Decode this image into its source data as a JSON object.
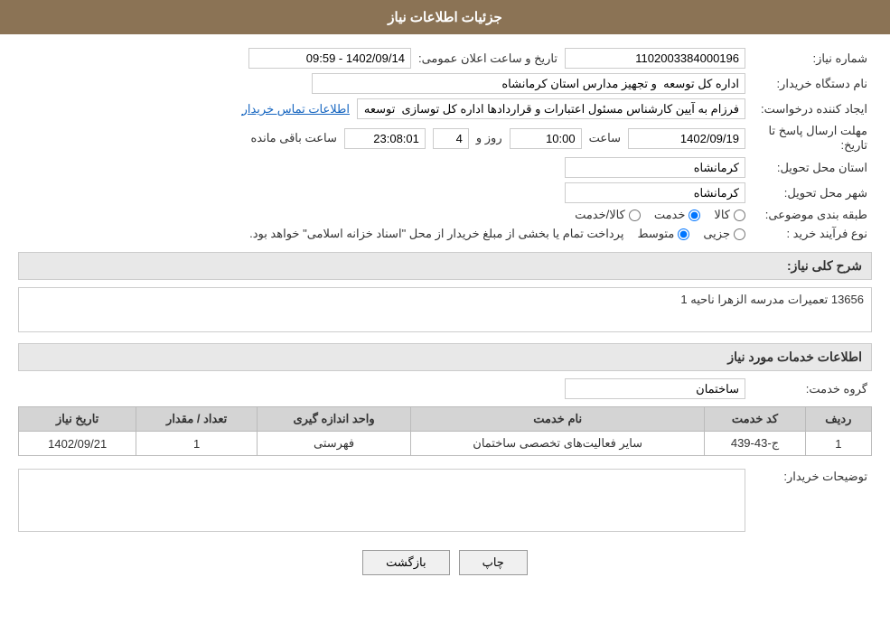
{
  "header": {
    "title": "جزئیات اطلاعات نیاز"
  },
  "form": {
    "need_number_label": "شماره نیاز:",
    "need_number_value": "1102003384000196",
    "announce_date_label": "تاریخ و ساعت اعلان عمومی:",
    "announce_date_value": "1402/09/14 - 09:59",
    "buyer_org_label": "نام دستگاه خریدار:",
    "buyer_org_value": "اداره کل توسعه  و تجهیز مدارس استان کرمانشاه",
    "creator_label": "ایجاد کننده درخواست:",
    "creator_value": "فرزام به آیین کارشناس مسئول اعتبارات و قراردادها اداره کل توسازی  توسعه و ت",
    "contact_link": "اطلاعات تماس خریدار",
    "deadline_label": "مهلت ارسال پاسخ تا تاریخ:",
    "deadline_date": "1402/09/19",
    "deadline_time_label": "ساعت",
    "deadline_time": "10:00",
    "deadline_days_label": "روز و",
    "deadline_days": "4",
    "deadline_remain_label": "ساعت باقی مانده",
    "deadline_remain": "23:08:01",
    "province_label": "استان محل تحویل:",
    "province_value": "کرمانشاه",
    "city_label": "شهر محل تحویل:",
    "city_value": "کرمانشاه",
    "category_label": "طبقه بندی موضوعی:",
    "category_options": [
      "کالا",
      "خدمت",
      "کالا/خدمت"
    ],
    "category_selected": "خدمت",
    "purchase_type_label": "نوع فرآیند خرید :",
    "purchase_type_options": [
      "جزیی",
      "متوسط"
    ],
    "purchase_type_note": "پرداخت تمام یا بخشی از مبلغ خریدار از محل \"اسناد خزانه اسلامی\" خواهد بود.",
    "purchase_type_selected": "متوسط",
    "need_summary_label": "شرح کلی نیاز:",
    "need_summary_value": "13656 تعمیرات مدرسه الزهرا ناحیه 1",
    "services_section_title": "اطلاعات خدمات مورد نیاز",
    "service_group_label": "گروه خدمت:",
    "service_group_value": "ساختمان",
    "table": {
      "columns": [
        "ردیف",
        "کد خدمت",
        "نام خدمت",
        "واحد اندازه گیری",
        "تعداد / مقدار",
        "تاریخ نیاز"
      ],
      "rows": [
        {
          "row_num": "1",
          "service_code": "ج-43-439",
          "service_name": "سایر فعالیت‌های تخصصی ساختمان",
          "unit": "فهرستی",
          "quantity": "1",
          "date": "1402/09/21"
        }
      ]
    },
    "buyer_notes_label": "توضیحات خریدار:",
    "buyer_notes_value": "",
    "btn_back": "بازگشت",
    "btn_print": "چاپ"
  }
}
